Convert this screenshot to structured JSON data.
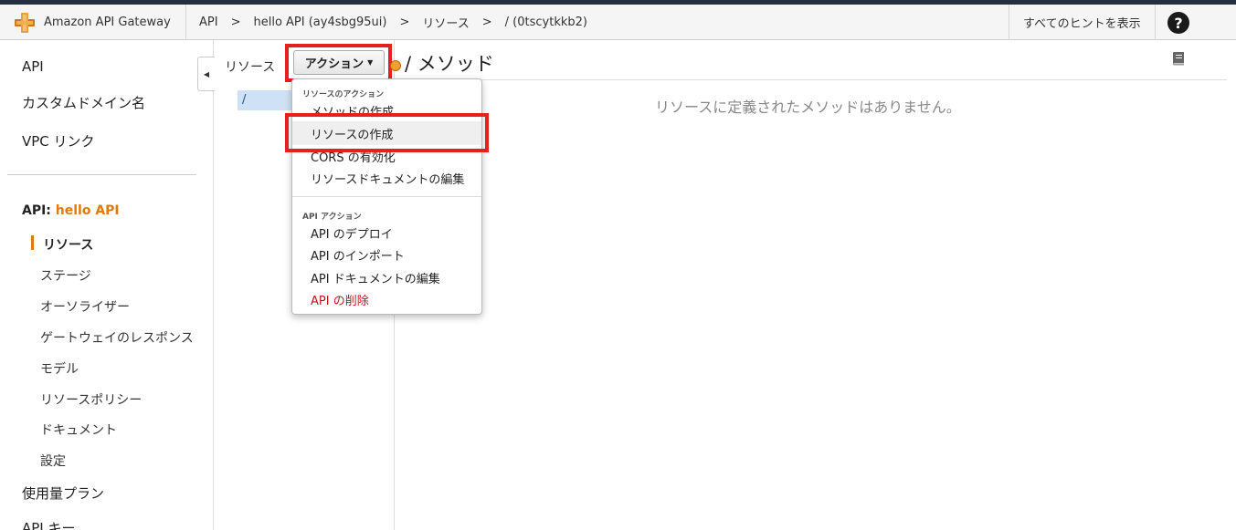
{
  "header": {
    "brand": "Amazon API Gateway",
    "breadcrumbs": [
      "API",
      ">",
      "hello API (ay4sbg95ui)",
      ">",
      "リソース",
      ">",
      "/ (0tscytkkb2)"
    ],
    "hints_label": "すべてのヒントを表示",
    "help_label": "?"
  },
  "sidebar": {
    "top_items": [
      "API",
      "カスタムドメイン名",
      "VPC リンク"
    ],
    "api_prefix": "API:",
    "api_name": "hello API",
    "active_item": "リソース",
    "sub_items": [
      "ステージ",
      "オーソライザー",
      "ゲートウェイのレスポンス",
      "モデル",
      "リソースポリシー",
      "ドキュメント",
      "設定"
    ],
    "bottom_items": [
      "使用量プラン",
      "API キー"
    ]
  },
  "resources": {
    "label": "リソース",
    "root": "/"
  },
  "actions": {
    "button_label": "アクション",
    "menu": {
      "resource_header": "リソースのアクション",
      "resource_items": [
        "メソッドの作成",
        "リソースの作成",
        "CORS の有効化",
        "リソースドキュメントの編集"
      ],
      "api_header": "API アクション",
      "api_items": [
        "API のデプロイ",
        "API のインポート",
        "API ドキュメントの編集"
      ],
      "danger_item": "API の削除"
    }
  },
  "main": {
    "title": "/ メソッド",
    "empty_message": "リソースに定義されたメソッドはありません。"
  },
  "colors": {
    "accent": "#e07a10",
    "highlight": "#e61f1f",
    "danger": "#c0141c",
    "selection": "#cfe2f5"
  }
}
